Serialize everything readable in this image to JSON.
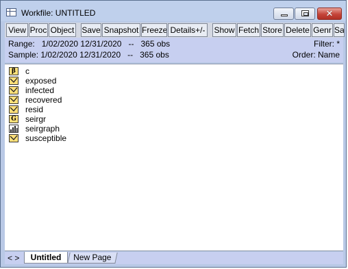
{
  "window": {
    "title": "Workfile: UNTITLED",
    "controls": {
      "minimize": "minimize",
      "maximize": "maximize",
      "close": "✕"
    }
  },
  "toolbar": {
    "buttons": [
      "View",
      "Proc",
      "Object",
      "Save",
      "Snapshot",
      "Freeze",
      "Details+/-",
      "Show",
      "Fetch",
      "Store",
      "Delete",
      "Genr",
      "Sa"
    ]
  },
  "info": {
    "range": "Range:   1/02/2020 12/31/2020   --   365 obs",
    "sample": "Sample: 1/02/2020 12/31/2020   --   365 obs",
    "filter": "Filter: *",
    "order": "Order: Name"
  },
  "objects": [
    {
      "name": "c",
      "icon": "coef-icon"
    },
    {
      "name": "exposed",
      "icon": "series-icon"
    },
    {
      "name": "infected",
      "icon": "series-icon"
    },
    {
      "name": "recovered",
      "icon": "series-icon"
    },
    {
      "name": "resid",
      "icon": "series-icon"
    },
    {
      "name": "seirgr",
      "icon": "group-icon"
    },
    {
      "name": "seirgraph",
      "icon": "graph-icon"
    },
    {
      "name": "susceptible",
      "icon": "series-icon"
    }
  ],
  "icon_glyphs": {
    "coef": "β",
    "group": "G"
  },
  "tabs": {
    "nav": "< >",
    "active": "Untitled",
    "new_page": "New Page"
  },
  "colors": {
    "icon_fill": "#ffe07a",
    "titlebar": "#bfd0ec",
    "info_bg": "#c7cff0"
  }
}
